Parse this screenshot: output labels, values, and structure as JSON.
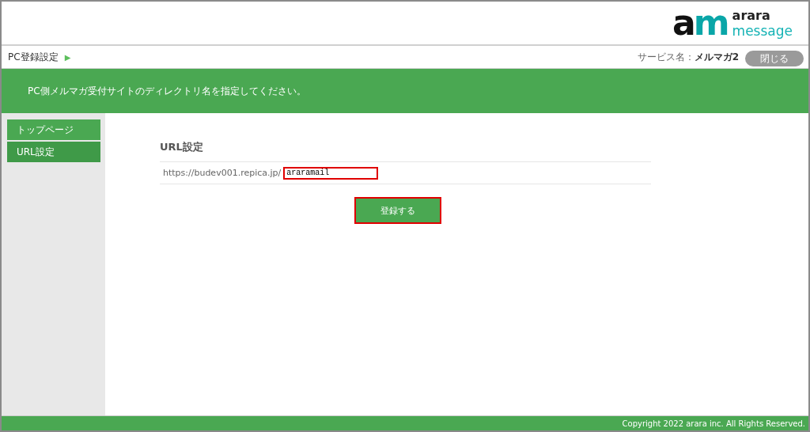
{
  "logo": {
    "mark_left": "a",
    "mark_right": "m",
    "line1": "arara",
    "line2": "message"
  },
  "breadcrumb": {
    "label": "PC登録設定",
    "arrow": "▶"
  },
  "service": {
    "label": "サービス名：",
    "value": "メルマガ2"
  },
  "close_button": "閉じる",
  "banner": "PC側メルマガ受付サイトのディレクトリ名を指定してください。",
  "sidebar": {
    "items": [
      {
        "label": "トップページ",
        "selected": false
      },
      {
        "label": "URL設定",
        "selected": true
      }
    ]
  },
  "form": {
    "title": "URL設定",
    "prefix": "https://budev001.repica.jp/",
    "value": "araramail",
    "field_highlighted": true,
    "submit": "登録する",
    "submit_highlighted": true
  },
  "footer": "Copyright 2022 arara inc. All Rights Reserved."
}
